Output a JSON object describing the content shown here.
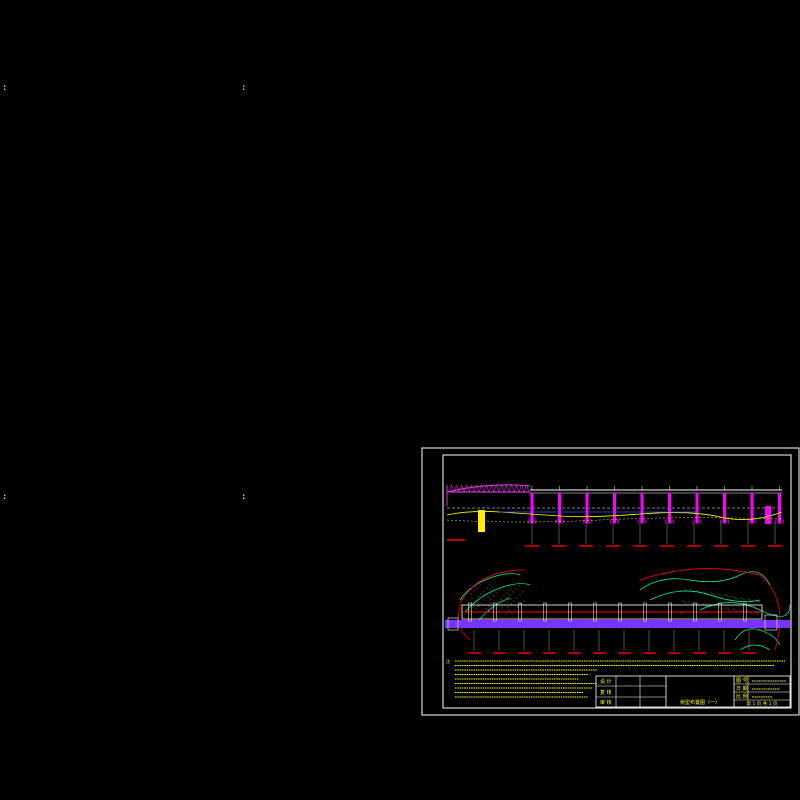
{
  "canvas": {
    "background": "#000000"
  },
  "corner_marks": [
    ":",
    ":",
    ":",
    ":"
  ],
  "sheet": {
    "frame_color": "#ffffff",
    "elevation": {
      "truss_color": "#cc33cc",
      "deck_color": "#ffffff",
      "pier_color": "#ff00ff",
      "ground_color": "#ffff00",
      "water_color": "#3355ff",
      "label_color": "#ff0000",
      "pier_count": 10
    },
    "plan": {
      "contour_color": "#00ff99",
      "boundary_color": "#ff0000",
      "axis_color": "#7a33ff",
      "deck_color": "#ffffff",
      "hatch_color": "#ffffff",
      "label_color": "#ff0000",
      "pier_count": 12
    },
    "notes": {
      "heading": "注：",
      "text_color": "#ffff00"
    },
    "title_block": {
      "roles": [
        "设 计",
        "复 核",
        "审 核"
      ],
      "drawing_title": "桥型布置图（一）",
      "fields": [
        "图 号",
        "日 期",
        "比 例"
      ],
      "sheet_no": "第 1 页  共 1 页",
      "text_color": "#ffff00",
      "line_color": "#ffffff"
    }
  }
}
